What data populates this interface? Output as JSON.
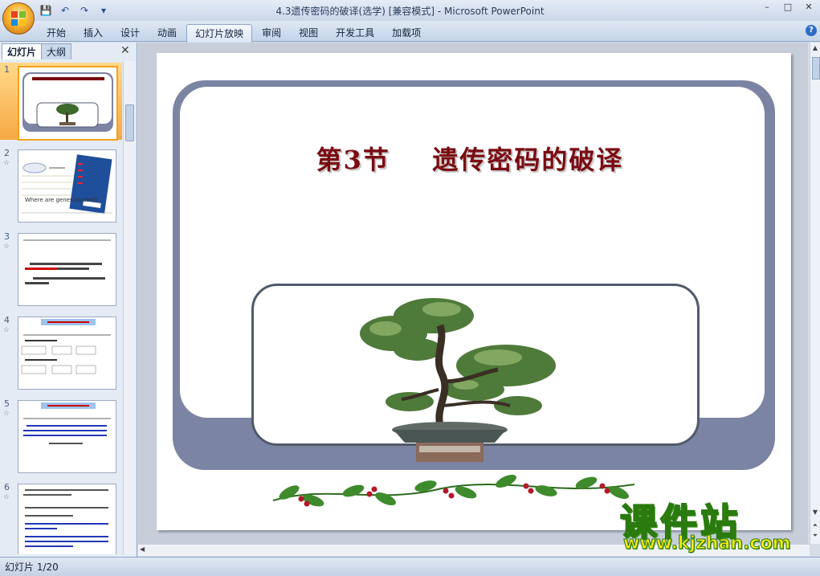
{
  "window": {
    "title": "4.3遗传密码的破译(选学) [兼容模式] - Microsoft PowerPoint",
    "controls": [
      "–",
      "□",
      "✕"
    ]
  },
  "quick_access": [
    "save-icon",
    "undo-icon",
    "redo-icon",
    "customize-icon"
  ],
  "ribbon": {
    "tabs": [
      "开始",
      "插入",
      "设计",
      "动画",
      "幻灯片放映",
      "审阅",
      "视图",
      "开发工具",
      "加载项"
    ],
    "active_tab": "幻灯片放映"
  },
  "left_pane": {
    "tabs": [
      "幻灯片",
      "大纲"
    ],
    "active_tab": "幻灯片",
    "close": "✕",
    "slides": [
      {
        "num": "1",
        "anim": ""
      },
      {
        "num": "2",
        "anim": "☆",
        "caption": "Where are genes located?"
      },
      {
        "num": "3",
        "anim": "☆"
      },
      {
        "num": "4",
        "anim": "☆"
      },
      {
        "num": "5",
        "anim": "☆"
      },
      {
        "num": "6",
        "anim": "☆"
      }
    ],
    "selected_slide": 1
  },
  "slide": {
    "title": "第3节    遗传密码的破译"
  },
  "status_bar": {
    "text": "幻灯片 1/20"
  },
  "watermark": {
    "name": "课件站",
    "url": "www.kjzhan.com"
  },
  "colors": {
    "title_red": "#7a0b12",
    "frame": "#7b84a3",
    "selected": "#f6a11c"
  }
}
